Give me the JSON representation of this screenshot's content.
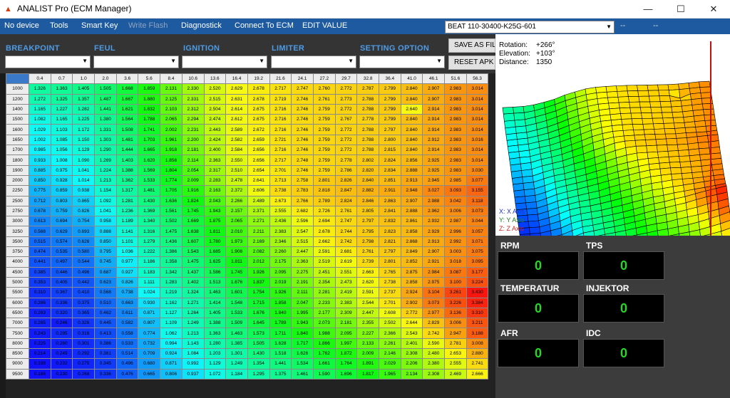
{
  "window": {
    "title": "ANALIST Pro (ECM Manager)",
    "minimize": "—",
    "maximize": "☐",
    "close": "✕"
  },
  "menu": {
    "items": [
      "No device",
      "Tools",
      "Smart Key",
      "Write Flash",
      "Diagnostick",
      "Connect  To ECM",
      "EDIT VALUE"
    ],
    "disabled": [
      "Write Flash"
    ]
  },
  "ecu_select": {
    "value": "BEAT 110-30400-K25G-601"
  },
  "dashes": [
    "--",
    "--"
  ],
  "filters": {
    "labels": [
      "BREAKPOINT",
      "FEUL",
      "IGNITION",
      "LIMITER",
      "SETTING OPTION"
    ]
  },
  "buttons": {
    "save": "SAVE AS FILE",
    "reset": "RESET APK"
  },
  "plot": {
    "rotation_label": "Rotation:",
    "rotation": "+266°",
    "elevation_label": "Elevation:",
    "elevation": "+103°",
    "distance_label": "Distance:",
    "distance": "1350",
    "legend": [
      {
        "text": "X: X Axis",
        "color": "#2030d0"
      },
      {
        "text": "Y: Y Axis",
        "color": "#208020"
      },
      {
        "text": "Z: Z Axis",
        "color": "#d02020"
      }
    ]
  },
  "gauges": [
    {
      "label": "RPM",
      "value": "0"
    },
    {
      "label": "TPS",
      "value": "0"
    },
    {
      "label": "TEMPERATUR",
      "value": "0"
    },
    {
      "label": "INJEKTOR",
      "value": "0"
    },
    {
      "label": "AFR",
      "value": "0"
    },
    {
      "label": "IDC",
      "value": "0"
    }
  ],
  "table": {
    "corner_icon": "row-select-icon",
    "col_headers": [
      "0.4",
      "0.7",
      "1.0",
      "2.0",
      "3.6",
      "5.6",
      "8.4",
      "10.6",
      "13.6",
      "16.4",
      "19.2",
      "21.6",
      "24.1",
      "27.2",
      "29.7",
      "32.8",
      "36.4",
      "41.0",
      "46.1",
      "51.6",
      "56.3"
    ],
    "rows": [
      {
        "rpm": "1000",
        "v": [
          "1.326",
          "1.363",
          "1.405",
          "1.505",
          "1.668",
          "1.859",
          "2.131",
          "2.330",
          "2.520",
          "2.629",
          "2.678",
          "2.717",
          "2.747",
          "2.760",
          "2.772",
          "2.787",
          "2.799",
          "2.840",
          "2.907",
          "2.983",
          "3.014"
        ]
      },
      {
        "rpm": "1200",
        "v": [
          "1.272",
          "1.325",
          "1.357",
          "1.487",
          "1.667",
          "1.880",
          "2.125",
          "2.331",
          "2.515",
          "2.631",
          "2.678",
          "2.719",
          "2.746",
          "2.761",
          "2.773",
          "2.788",
          "2.799",
          "2.840",
          "2.907",
          "2.983",
          "3.014"
        ]
      },
      {
        "rpm": "1400",
        "v": [
          "1.165",
          "1.227",
          "1.282",
          "1.441",
          "1.621",
          "1.832",
          "2.103",
          "2.312",
          "2.504",
          "2.614",
          "2.675",
          "2.716",
          "2.746",
          "2.759",
          "2.772",
          "2.788",
          "2.799",
          "2.640",
          "2.914",
          "2.983",
          "3.014"
        ]
      },
      {
        "rpm": "1500",
        "v": [
          "1.082",
          "1.165",
          "1.225",
          "1.380",
          "1.564",
          "1.788",
          "2.065",
          "2.294",
          "2.474",
          "2.612",
          "2.675",
          "2.716",
          "2.746",
          "2.759",
          "2.767",
          "2.778",
          "2.799",
          "2.840",
          "2.914",
          "2.983",
          "3.014"
        ]
      },
      {
        "rpm": "1600",
        "v": [
          "1.029",
          "1.103",
          "1.172",
          "1.331",
          "1.508",
          "1.741",
          "2.002",
          "2.231",
          "2.443",
          "2.589",
          "2.672",
          "2.716",
          "2.746",
          "2.759",
          "2.772",
          "2.788",
          "2.797",
          "2.840",
          "2.914",
          "2.983",
          "3.014"
        ]
      },
      {
        "rpm": "1650",
        "v": [
          "1.002",
          "1.085",
          "1.150",
          "1.303",
          "1.481",
          "1.703",
          "1.961",
          "2.200",
          "2.424",
          "2.582",
          "2.659",
          "2.721",
          "2.746",
          "2.759",
          "2.772",
          "2.788",
          "2.800",
          "2.840",
          "2.912",
          "2.983",
          "3.016"
        ]
      },
      {
        "rpm": "1700",
        "v": [
          "0.985",
          "1.056",
          "1.129",
          "1.290",
          "1.444",
          "1.665",
          "1.918",
          "2.181",
          "2.400",
          "2.584",
          "2.656",
          "2.716",
          "2.746",
          "2.759",
          "2.772",
          "2.788",
          "2.815",
          "2.840",
          "2.914",
          "2.983",
          "3.014"
        ]
      },
      {
        "rpm": "1800",
        "v": [
          "0.933",
          "1.008",
          "1.090",
          "1.269",
          "1.403",
          "1.620",
          "1.856",
          "2.114",
          "2.363",
          "2.550",
          "2.656",
          "2.717",
          "2.748",
          "2.759",
          "2.778",
          "2.802",
          "2.824",
          "2.856",
          "2.925",
          "2.983",
          "3.014"
        ]
      },
      {
        "rpm": "1900",
        "v": [
          "0.885",
          "0.975",
          "1.041",
          "1.224",
          "1.388",
          "1.569",
          "1.804",
          "2.054",
          "2.317",
          "2.510",
          "2.654",
          "2.701",
          "2.746",
          "2.759",
          "2.786",
          "2.820",
          "2.834",
          "2.888",
          "2.925",
          "2.983",
          "3.030"
        ]
      },
      {
        "rpm": "2000",
        "v": [
          "0.850",
          "0.928",
          "1.014",
          "1.213",
          "1.362",
          "1.533",
          "1.774",
          "2.009",
          "2.283",
          "2.478",
          "2.641",
          "2.713",
          "2.758",
          "2.801",
          "2.826",
          "2.840",
          "2.851",
          "2.913",
          "2.945",
          "2.985",
          "3.077"
        ]
      },
      {
        "rpm": "2250",
        "v": [
          "0.775",
          "0.859",
          "0.938",
          "1.154",
          "1.317",
          "1.481",
          "1.705",
          "1.916",
          "2.163",
          "2.372",
          "2.606",
          "2.738",
          "2.783",
          "2.818",
          "2.847",
          "2.882",
          "2.911",
          "2.948",
          "3.027",
          "3.093",
          "3.155"
        ]
      },
      {
        "rpm": "2500",
        "v": [
          "0.712",
          "0.803",
          "0.865",
          "1.092",
          "1.281",
          "1.430",
          "1.636",
          "1.824",
          "2.043",
          "2.266",
          "2.489",
          "2.673",
          "2.766",
          "2.789",
          "2.824",
          "2.846",
          "2.863",
          "2.907",
          "2.988",
          "3.042",
          "3.118"
        ]
      },
      {
        "rpm": "2750",
        "v": [
          "0.678",
          "0.759",
          "0.826",
          "1.041",
          "1.236",
          "1.369",
          "1.561",
          "1.745",
          "1.943",
          "2.157",
          "2.371",
          "2.555",
          "2.682",
          "2.726",
          "2.761",
          "2.805",
          "2.841",
          "2.888",
          "2.962",
          "3.006",
          "3.073"
        ]
      },
      {
        "rpm": "3000",
        "v": [
          "0.613",
          "0.694",
          "0.754",
          "0.958",
          "1.189",
          "1.340",
          "1.502",
          "1.669",
          "1.875",
          "2.065",
          "2.271",
          "2.436",
          "2.596",
          "2.694",
          "2.747",
          "2.797",
          "2.832",
          "2.861",
          "2.932",
          "2.987",
          "3.044"
        ]
      },
      {
        "rpm": "3250",
        "v": [
          "0.568",
          "0.629",
          "0.693",
          "0.888",
          "1.141",
          "1.316",
          "1.475",
          "1.638",
          "1.811",
          "2.010",
          "2.211",
          "2.383",
          "2.547",
          "2.678",
          "2.744",
          "2.795",
          "2.823",
          "2.858",
          "2.929",
          "2.996",
          "3.057"
        ]
      },
      {
        "rpm": "3500",
        "v": [
          "0.515",
          "0.574",
          "0.626",
          "0.850",
          "1.101",
          "1.279",
          "1.436",
          "1.607",
          "1.780",
          "1.973",
          "2.169",
          "2.346",
          "2.515",
          "2.662",
          "2.742",
          "2.798",
          "2.821",
          "2.868",
          "2.913",
          "2.992",
          "3.071"
        ]
      },
      {
        "rpm": "3750",
        "v": [
          "0.474",
          "0.535",
          "0.580",
          "0.795",
          "1.036",
          "1.222",
          "1.386",
          "1.543",
          "1.685",
          "1.908",
          "2.082",
          "2.260",
          "2.447",
          "2.591",
          "2.681",
          "2.761",
          "2.797",
          "2.849",
          "2.907",
          "3.003",
          "3.075"
        ]
      },
      {
        "rpm": "4000",
        "v": [
          "0.441",
          "0.497",
          "0.544",
          "0.745",
          "0.977",
          "1.186",
          "1.358",
          "1.475",
          "1.625",
          "1.811",
          "2.012",
          "2.175",
          "2.363",
          "2.519",
          "2.619",
          "2.739",
          "2.801",
          "2.852",
          "2.921",
          "3.018",
          "3.095"
        ]
      },
      {
        "rpm": "4500",
        "v": [
          "0.385",
          "0.446",
          "0.496",
          "0.687",
          "0.927",
          "1.183",
          "1.342",
          "1.437",
          "1.586",
          "1.745",
          "1.926",
          "2.095",
          "2.275",
          "2.451",
          "2.551",
          "2.663",
          "2.765",
          "2.875",
          "2.984",
          "3.087",
          "3.177"
        ]
      },
      {
        "rpm": "5000",
        "v": [
          "0.353",
          "0.405",
          "0.442",
          "0.623",
          "0.826",
          "1.111",
          "1.283",
          "1.402",
          "1.513",
          "1.676",
          "1.837",
          "2.019",
          "2.191",
          "2.354",
          "2.473",
          "2.620",
          "2.738",
          "2.858",
          "2.975",
          "3.100",
          "3.224"
        ]
      },
      {
        "rpm": "5500",
        "v": [
          "0.310",
          "0.367",
          "0.410",
          "0.568",
          "0.738",
          "1.024",
          "1.219",
          "1.324",
          "1.463",
          "1.601",
          "1.754",
          "1.926",
          "2.111",
          "2.281",
          "2.419",
          "2.591",
          "2.737",
          "2.924",
          "3.104",
          "3.261",
          "3.430"
        ]
      },
      {
        "rpm": "6000",
        "v": [
          "0.286",
          "0.336",
          "0.375",
          "0.510",
          "0.663",
          "0.930",
          "1.162",
          "1.271",
          "1.414",
          "1.548",
          "1.715",
          "1.858",
          "2.047",
          "2.233",
          "2.383",
          "2.544",
          "2.701",
          "2.902",
          "3.073",
          "3.226",
          "3.384"
        ]
      },
      {
        "rpm": "6500",
        "v": [
          "0.263",
          "0.320",
          "0.365",
          "0.462",
          "0.611",
          "0.871",
          "1.127",
          "1.264",
          "1.405",
          "1.533",
          "1.676",
          "1.840",
          "1.995",
          "2.177",
          "2.309",
          "2.447",
          "2.608",
          "2.772",
          "2.977",
          "3.136",
          "3.310"
        ]
      },
      {
        "rpm": "7000",
        "v": [
          "0.265",
          "0.246",
          "0.326",
          "0.445",
          "0.582",
          "0.807",
          "1.109",
          "1.249",
          "1.388",
          "1.509",
          "1.645",
          "1.789",
          "1.943",
          "2.073",
          "2.181",
          "2.355",
          "2.502",
          "2.644",
          "2.829",
          "3.006",
          "3.211"
        ]
      },
      {
        "rpm": "7500",
        "v": [
          "0.243",
          "0.295",
          "0.316",
          "0.413",
          "0.558",
          "0.774",
          "1.062",
          "1.213",
          "1.363",
          "1.463",
          "1.573",
          "1.711",
          "1.840",
          "1.988",
          "2.095",
          "2.227",
          "2.366",
          "2.543",
          "2.742",
          "2.947",
          "3.188"
        ]
      },
      {
        "rpm": "8000",
        "v": [
          "0.225",
          "0.260",
          "0.301",
          "0.386",
          "0.533",
          "0.732",
          "0.994",
          "1.143",
          "1.280",
          "1.385",
          "1.505",
          "1.628",
          "1.717",
          "1.866",
          "1.997",
          "2.133",
          "2.261",
          "2.401",
          "2.590",
          "2.781",
          "3.008"
        ]
      },
      {
        "rpm": "8500",
        "v": [
          "0.214",
          "0.249",
          "0.292",
          "0.361",
          "0.514",
          "0.709",
          "0.924",
          "1.084",
          "1.203",
          "1.301",
          "1.430",
          "1.518",
          "1.626",
          "1.762",
          "1.872",
          "2.009",
          "2.146",
          "2.308",
          "2.480",
          "2.653",
          "2.880"
        ]
      },
      {
        "rpm": "9000",
        "v": [
          "0.198",
          "0.232",
          "0.275",
          "0.345",
          "0.496",
          "0.680",
          "0.871",
          "0.992",
          "1.129",
          "1.249",
          "1.354",
          "1.441",
          "1.534",
          "1.661",
          "1.764",
          "1.891",
          "2.029",
          "2.206",
          "2.380",
          "2.555",
          "2.741"
        ]
      },
      {
        "rpm": "9500",
        "v": [
          "0.186",
          "0.230",
          "0.268",
          "0.336",
          "0.476",
          "0.665",
          "0.806",
          "0.937",
          "1.072",
          "1.184",
          "1.295",
          "1.375",
          "1.461",
          "1.590",
          "1.696",
          "1.817",
          "1.965",
          "2.134",
          "2.308",
          "2.469",
          "2.666"
        ]
      }
    ]
  }
}
